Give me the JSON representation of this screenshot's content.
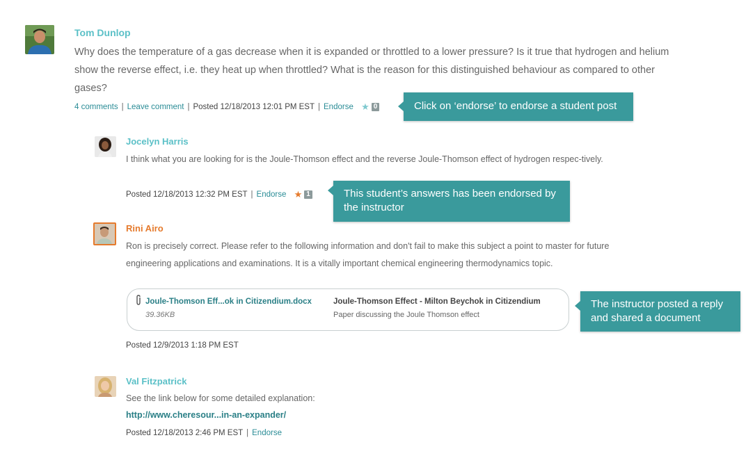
{
  "colors": {
    "accent": "#5bc0c7",
    "link": "#2a8c96",
    "callout": "#3a9a9c",
    "instructor": "#e57a2c",
    "star_instructor": "#e57a2c",
    "star_default": "#7fc9cf"
  },
  "main_post": {
    "author": "Tom Dunlop",
    "text": "Why does the temperature of a gas decrease when it is expanded or throttled to a lower pressure? Is it true that hydrogen and helium show the reverse effect, i.e. they heat up when throttled? What is the reason for this distinguished behaviour as compared to other gases?",
    "comments_link": "4 comments",
    "leave_comment": "Leave comment",
    "posted": "Posted 12/18/2013 12:01 PM EST",
    "endorse": "Endorse",
    "endorse_count": "0"
  },
  "callouts": {
    "endorse_tip": "Click on ‘endorse’ to endorse a student post",
    "endorsed_tip": "This student’s answers has been endorsed by the instructor",
    "instructor_tip": "The instructor posted a reply and shared a document"
  },
  "replies": [
    {
      "author": "Jocelyn Harris",
      "text": "I think what you are looking for is the Joule-Thomson effect and the reverse Joule-Thomson effect of hydrogen respec-tively.",
      "posted": "Posted 12/18/2013 12:32 PM EST",
      "endorse": "Endorse",
      "endorse_count": "1"
    },
    {
      "author": "Rini Airo",
      "text": "Ron is precisely correct. Please refer to the following information and don't fail to make this subject a point to master for future engineering applications and examinations. It is a vitally important chemical engineering thermodynamics topic.",
      "posted": "Posted 12/9/2013 1:18 PM EST",
      "attachment": {
        "filename": "Joule-Thomson Eff...ok in Citizendium.docx",
        "size": "39.36KB",
        "title": "Joule-Thomson Effect - Milton Beychok in Citizendium",
        "description": "Paper discussing the Joule Thomson effect"
      }
    },
    {
      "author": "Val Fitzpatrick",
      "text": "See the link below for some detailed explanation:",
      "link": "http://www.cheresour...in-an-expander/",
      "posted": "Posted 12/18/2013 2:46 PM EST",
      "endorse": "Endorse"
    }
  ]
}
